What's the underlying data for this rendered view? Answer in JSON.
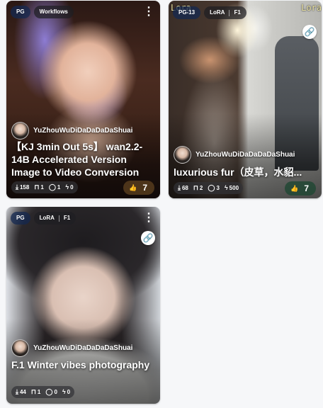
{
  "cards": [
    {
      "tags": [
        "PG",
        "Workflows"
      ],
      "user": "YuZhouWuDiDaDaDaDaShuai",
      "title": "【KJ 3min Out 5s】 wan2.2-14B Accelerated Version Image to Video Conversion",
      "stats": {
        "downloads": "158",
        "collects": "1",
        "comments": "1",
        "buzz": "0"
      },
      "reaction": {
        "icon": "thumbs-up-icon",
        "count": "7"
      }
    },
    {
      "corner_label": "Lora",
      "tags": [
        "PG-13",
        "LoRA",
        "F1"
      ],
      "user": "YuZhouWuDiDaDaDaDaShuai",
      "title": "luxurious fur（皮草，水貂...",
      "stats": {
        "downloads": "68",
        "collects": "2",
        "comments": "3",
        "buzz": "500"
      },
      "reaction": {
        "icon": "thumbs-up-icon",
        "count": "7"
      }
    },
    {
      "tags": [
        "PG",
        "LoRA",
        "F1"
      ],
      "user": "YuZhouWuDiDaDaDaDaShuai",
      "title": "F.1 Winter vibes photography",
      "stats": {
        "downloads": "44",
        "collects": "1",
        "comments": "0",
        "buzz": "0"
      }
    }
  ],
  "icons": {
    "menu": "⋮",
    "link": "🔗",
    "download": "⤓",
    "collect": "⊓",
    "comment": "◯",
    "buzz": "ϟ",
    "like": "👍"
  }
}
